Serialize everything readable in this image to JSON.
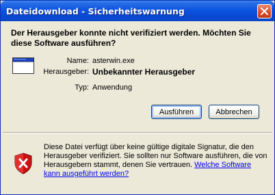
{
  "window": {
    "title": "Dateidownload - Sicherheitswarnung"
  },
  "question": "Der Herausgeber konnte nicht verifiziert werden. Möchten Sie diese Software ausführen?",
  "details": {
    "name_label": "Name:",
    "name_value": "asterwin.exe",
    "publisher_label": "Herausgeber:",
    "publisher_value": "Unbekannter Herausgeber",
    "type_label": "Typ:",
    "type_value": "Anwendung"
  },
  "buttons": {
    "run": "Ausführen",
    "cancel": "Abbrechen"
  },
  "warning": {
    "text": "Diese Datei verfügt über keine gültige digitale Signatur, die den Herausgeber verifiziert. Sie sollten nur Software ausführen, die von Herausgebern stammt, denen Sie vertrauen.",
    "link": "Welche Software kann ausgeführt werden?"
  },
  "icons": {
    "close": "close-icon",
    "file": "application-window-icon",
    "warning": "shield-error-icon"
  },
  "colors": {
    "titlebar": "#0a48d2",
    "close_button": "#d84a20",
    "dialog_bg": "#ece9d8",
    "link": "#0000ee",
    "shield_red": "#cc1010"
  }
}
